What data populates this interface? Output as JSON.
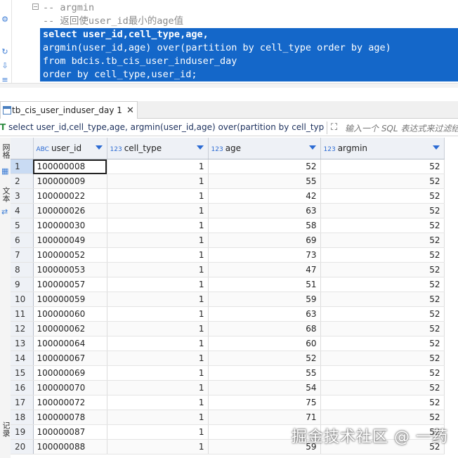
{
  "editor": {
    "lines": [
      "-- argmin",
      "-- 返回使user_id最小的age值",
      "select user_id,cell_type,age,",
      "argmin(user_id,age) over(partition by cell_type order by age)",
      "from bdcis.tb_cis_user_induser_day",
      "order by cell_type,user_id;"
    ],
    "fold_symbol": "−"
  },
  "results_tab": {
    "label": "tb_cis_user_induser_day 1",
    "close": "✕"
  },
  "filter": {
    "icon": "T",
    "query": "select user_id,cell_type,age, argmin(user_id,age) over(partition by cell_type order by age)",
    "placeholder": "输入一个 SQL 表达式来过滤结果",
    "expand_icon": "⛶"
  },
  "side_panel": {
    "grid_label": "网格",
    "text_label": "文本",
    "record_label": "记录"
  },
  "grid": {
    "columns": [
      {
        "name": "user_id",
        "type": "ABC"
      },
      {
        "name": "cell_type",
        "type": "123"
      },
      {
        "name": "age",
        "type": "123"
      },
      {
        "name": "argmin",
        "type": "123"
      }
    ],
    "rows": [
      [
        "1",
        "100000008",
        "1",
        "52",
        "52"
      ],
      [
        "2",
        "100000009",
        "1",
        "55",
        "52"
      ],
      [
        "3",
        "100000022",
        "1",
        "42",
        "52"
      ],
      [
        "4",
        "100000026",
        "1",
        "63",
        "52"
      ],
      [
        "5",
        "100000030",
        "1",
        "58",
        "52"
      ],
      [
        "6",
        "100000049",
        "1",
        "69",
        "52"
      ],
      [
        "7",
        "100000052",
        "1",
        "73",
        "52"
      ],
      [
        "8",
        "100000053",
        "1",
        "47",
        "52"
      ],
      [
        "9",
        "100000057",
        "1",
        "51",
        "52"
      ],
      [
        "10",
        "100000059",
        "1",
        "59",
        "52"
      ],
      [
        "11",
        "100000060",
        "1",
        "63",
        "52"
      ],
      [
        "12",
        "100000062",
        "1",
        "68",
        "52"
      ],
      [
        "13",
        "100000064",
        "1",
        "60",
        "52"
      ],
      [
        "14",
        "100000067",
        "1",
        "52",
        "52"
      ],
      [
        "15",
        "100000069",
        "1",
        "55",
        "52"
      ],
      [
        "16",
        "100000070",
        "1",
        "54",
        "52"
      ],
      [
        "17",
        "100000072",
        "1",
        "75",
        "52"
      ],
      [
        "18",
        "100000078",
        "1",
        "71",
        "52"
      ],
      [
        "19",
        "100000087",
        "1",
        "",
        "52"
      ],
      [
        "20",
        "100000088",
        "1",
        "59",
        "52"
      ]
    ]
  },
  "watermark": "掘金技术社区 @ 一药"
}
